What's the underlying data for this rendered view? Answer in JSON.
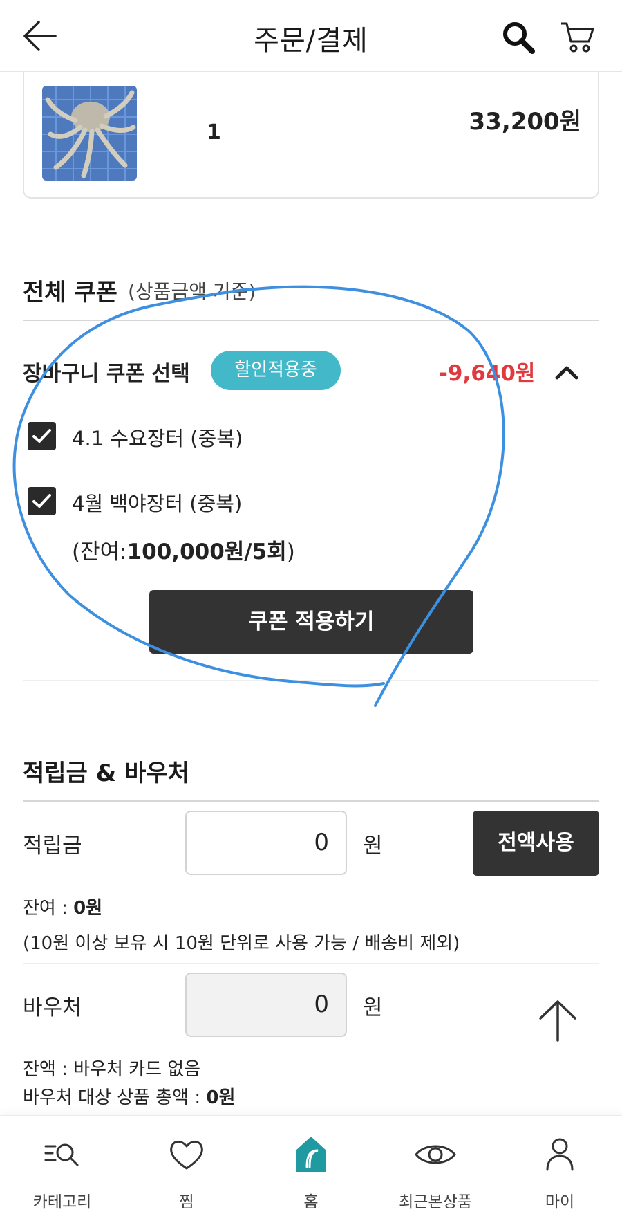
{
  "header": {
    "title": "주문/결제"
  },
  "product": {
    "quantity": "1",
    "price": "33,200원"
  },
  "total_coupon": {
    "title": "전체 쿠폰",
    "subtitle": "(상품금액 기준)",
    "cart_coupon_label": "장바구니 쿠폰 선택",
    "badge": "할인적용중",
    "discount": "-9,640원",
    "coupons": [
      {
        "label": "4.1 수요장터 (중복)",
        "checked": true
      },
      {
        "label": "4월 백야장터 (중복)",
        "checked": true
      }
    ],
    "remaining_prefix": "(잔여:",
    "remaining_value": "100,000원/5회",
    "remaining_suffix": ")",
    "apply_button": "쿠폰 적용하기"
  },
  "points": {
    "title": "적립금 & 바우처",
    "points_label": "적립금",
    "points_value": "0",
    "unit": "원",
    "full_use_button": "전액사용",
    "balance_prefix": "잔여 : ",
    "balance_value": "0원",
    "rule_note": "(10원 이상 보유 시 10원 단위로 사용 가능 / 배송비 제외)",
    "voucher_label": "바우처",
    "voucher_value": "0",
    "voucher_balance": "잔액 : 바우처 카드 없음",
    "voucher_total_prefix": "바우처 대상 상품 총액 : ",
    "voucher_total_value": "0원"
  },
  "bottom_nav": [
    {
      "label": "카테고리",
      "icon": "category-search-icon"
    },
    {
      "label": "찜",
      "icon": "heart-icon"
    },
    {
      "label": "홈",
      "icon": "home-icon"
    },
    {
      "label": "최근본상품",
      "icon": "eye-icon"
    },
    {
      "label": "마이",
      "icon": "person-icon"
    }
  ],
  "colors": {
    "accent_teal": "#43b8c8",
    "discount_red": "#e0393e",
    "button_dark": "#333333",
    "annotation_blue": "#3d8fe0"
  }
}
